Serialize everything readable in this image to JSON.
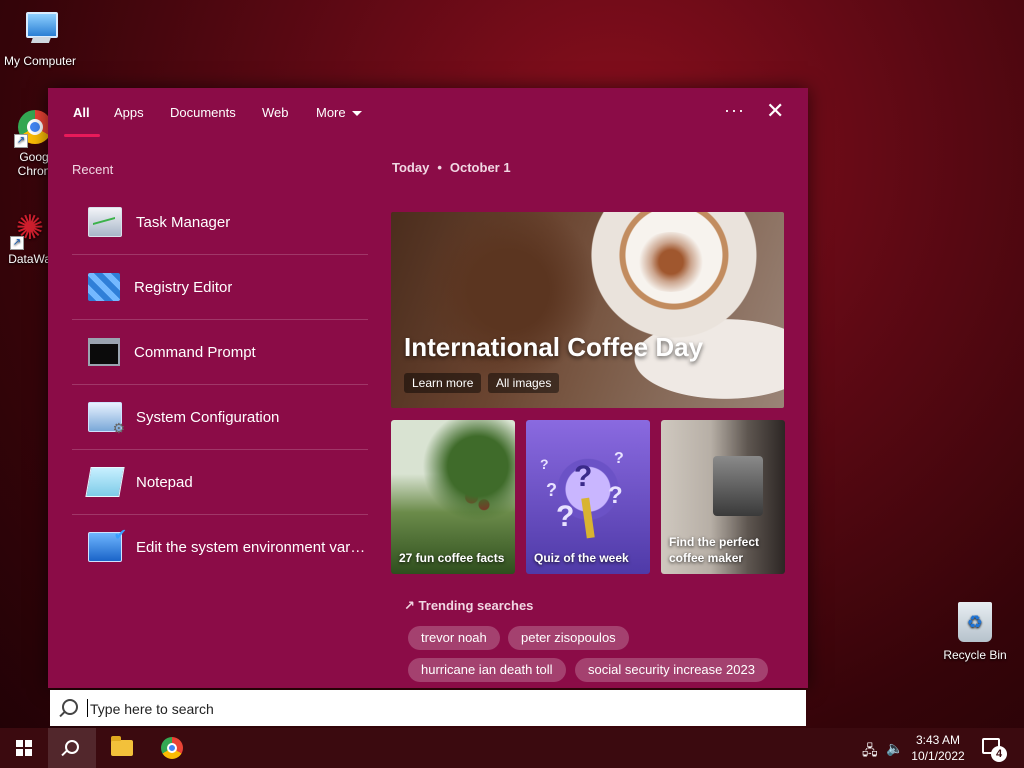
{
  "desktop": {
    "icons": [
      {
        "label": "My Computer",
        "icon": "computer-icon"
      },
      {
        "label": "Goog Chron",
        "icon": "chrome-icon"
      },
      {
        "label": "DataWag",
        "icon": "datawag-icon"
      }
    ],
    "recycle_bin": {
      "label": "Recycle Bin",
      "icon": "recycle-bin-icon"
    }
  },
  "search_panel": {
    "tabs": [
      "All",
      "Apps",
      "Documents",
      "Web",
      "More"
    ],
    "active_tab": "All",
    "accent_color": "#e81a5a",
    "background_color": "#8b0c47",
    "recent": {
      "title": "Recent",
      "items": [
        {
          "label": "Task Manager",
          "icon": "task-manager-icon"
        },
        {
          "label": "Registry Editor",
          "icon": "registry-editor-icon"
        },
        {
          "label": "Command Prompt",
          "icon": "command-prompt-icon"
        },
        {
          "label": "System Configuration",
          "icon": "system-configuration-icon"
        },
        {
          "label": "Notepad",
          "icon": "notepad-icon"
        },
        {
          "label": "Edit the system environment vari...",
          "icon": "system-properties-icon"
        }
      ]
    },
    "today": {
      "label": "Today",
      "date": "October 1"
    },
    "hero": {
      "title": "International Coffee Day",
      "buttons": [
        "Learn more",
        "All images"
      ]
    },
    "cards": [
      {
        "label": "27 fun coffee facts"
      },
      {
        "label": "Quiz of the week"
      },
      {
        "label": "Find the perfect coffee maker"
      }
    ],
    "trending": {
      "title": "Trending searches",
      "chips": [
        "trevor noah",
        "peter zisopoulos",
        "hurricane ian death toll",
        "social security increase 2023"
      ]
    }
  },
  "search_box": {
    "placeholder": "Type here to search",
    "value": ""
  },
  "taskbar": {
    "items": [
      "start-icon",
      "search-icon",
      "file-explorer-icon",
      "chrome-icon"
    ],
    "tray": [
      "network-icon",
      "volume-icon"
    ],
    "time": "3:43 AM",
    "date": "10/1/2022",
    "notification_count": "4"
  }
}
